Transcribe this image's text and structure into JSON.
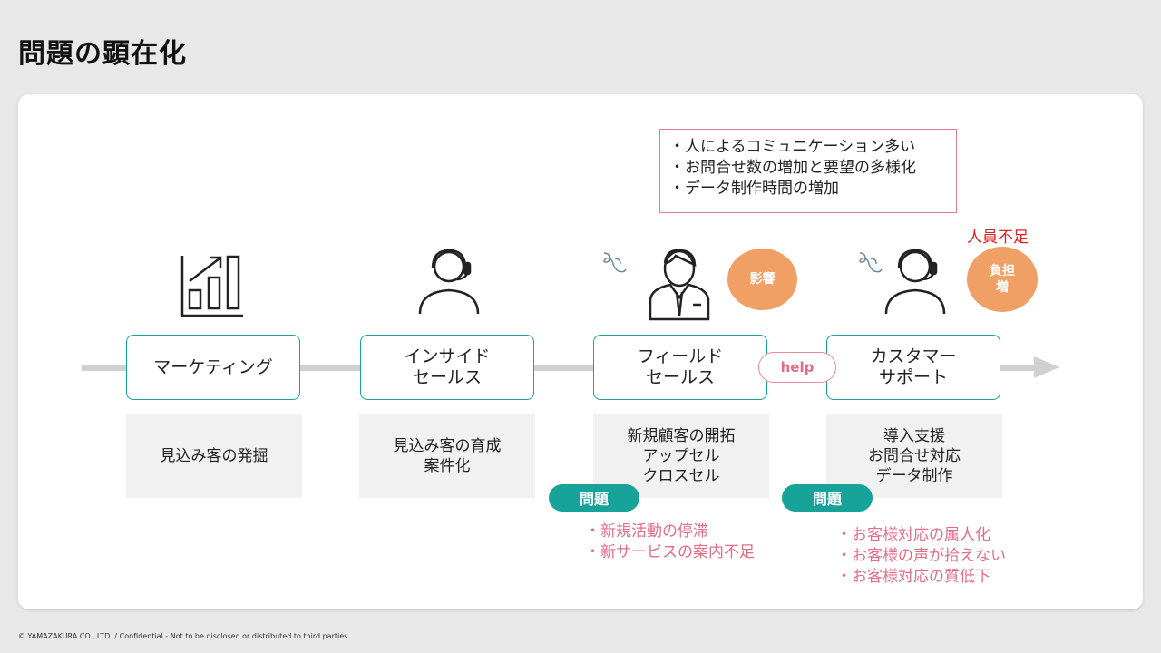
{
  "page_title": "問題の顕在化",
  "footer": "© YAMAZAKURA CO., LTD. / Confidential - Not to be disclosed or distributed to third parties.",
  "note": "・人によるコミュニケーション多い\n・お問合せ数の増加と要望の多様化\n・データ制作時間の増加",
  "shortage_label": "人員不足",
  "impact_label": "影響",
  "burden_label": "負担\n増",
  "help_label": "help",
  "stages": [
    {
      "label": "マーケティング",
      "desc": "見込み客の発掘"
    },
    {
      "label": "インサイド\nセールス",
      "desc": "見込み客の育成\n案件化"
    },
    {
      "label": "フィールド\nセールス",
      "desc": "新規顧客の開拓\nアップセル\nクロスセル"
    },
    {
      "label": "カスタマー\nサポート",
      "desc": "導入支援\nお問合せ対応\nデータ制作"
    }
  ],
  "problems": [
    {
      "tag": "問題",
      "items": "・新規活動の停滞\n・新サービスの案内不足"
    },
    {
      "tag": "問題",
      "items": "・お客様対応の属人化\n・お客様の声が拾えない\n・お客様対応の質低下"
    }
  ],
  "icons": {
    "marketing": "growth-chart-icon",
    "inside_sales": "headset-operator-icon",
    "field_sales": "businessman-icon",
    "customer_support": "headset-operator-icon",
    "stress": "stress-squiggle-icon"
  },
  "colors": {
    "teal": "#1aa39a",
    "orange": "#f0a064",
    "pink": "#e46d86",
    "red": "#e02020"
  }
}
